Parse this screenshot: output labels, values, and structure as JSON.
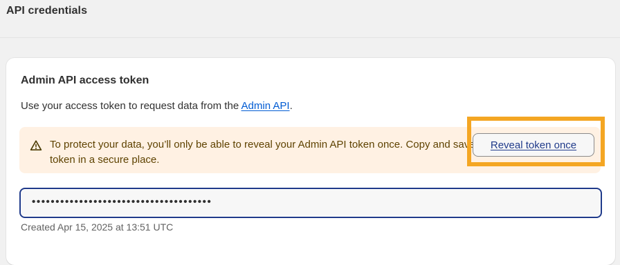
{
  "page": {
    "title": "API credentials"
  },
  "card": {
    "title": "Admin API access token",
    "description_prefix": "Use your access token to request data from the ",
    "description_link": "Admin API",
    "description_suffix": "."
  },
  "banner": {
    "icon": "warning-triangle-icon",
    "text": "To protect your data, you’ll only be able to reveal your Admin API token once. Copy and save your Admin API access token in a secure place.",
    "background_color": "#fff1e3"
  },
  "token": {
    "masked_value": "••••••••••••••••••••••••••••••••••••••",
    "reveal_label": "Reveal token once",
    "created_text": "Created Apr 15, 2025 at 13:51 UTC"
  },
  "colors": {
    "link": "#005bd3",
    "highlight": "#f4a623",
    "focus_border": "#1f3a8a"
  }
}
